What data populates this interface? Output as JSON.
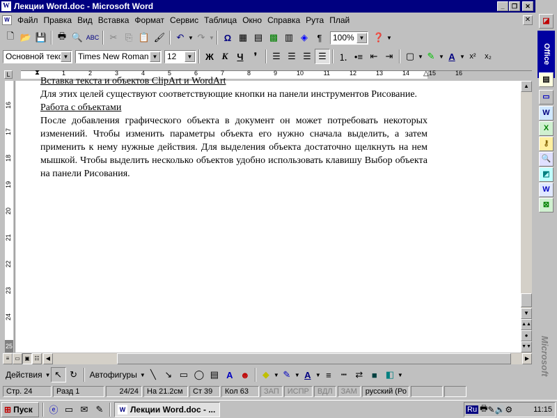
{
  "window": {
    "title": "Лекции Word.doc - Microsoft Word",
    "icon_letter": "W"
  },
  "menu": [
    "Файл",
    "Правка",
    "Вид",
    "Вставка",
    "Формат",
    "Сервис",
    "Таблица",
    "Окно",
    "Справка",
    "Рута",
    "Плай"
  ],
  "standard_toolbar": {
    "zoom": "100%"
  },
  "formatting_toolbar": {
    "style": "Основной текст",
    "font": "Times New Roman",
    "size": "12",
    "bold": "Ж",
    "italic": "К",
    "underline": "Ч",
    "superscript": "x²",
    "subscript": "x₂"
  },
  "ruler": {
    "numbers": [
      "1",
      "2",
      "3",
      "4",
      "5",
      "6",
      "7",
      "8",
      "9",
      "10",
      "11",
      "12",
      "13",
      "14",
      "15",
      "16"
    ]
  },
  "vruler": {
    "numbers": [
      "16",
      "17",
      "18",
      "19",
      "20",
      "21",
      "22",
      "23",
      "24",
      "25"
    ]
  },
  "document": {
    "line_cut": "Вставка текста и объектов ClipArt и WordArt",
    "para1": "Для этих целей существуют соответствующие кнопки на панели инструментов Рисование.",
    "heading2": "Работа с объектами",
    "para2": "После добавления графического объекта в документ он может потребовать некоторых изменений. Чтобы изменить параметры объекта его нужно сначала выделить, а затем применить к нему нужные действия. Для выделения объекта достаточно щелкнуть на нем мышкой. Чтобы выделить несколько объектов удобно использовать клавишу Выбор объекта на панели Рисования."
  },
  "drawing_toolbar": {
    "actions": "Действия",
    "autoshapes": "Автофигуры"
  },
  "status_bar": {
    "page": "Стр. 24",
    "section": "Разд 1",
    "pages": "24/24",
    "at": "На 21.2см",
    "line": "Ст 39",
    "col": "Кол 63",
    "rec": "ЗАП",
    "trk": "ИСПР",
    "ext": "ВДЛ",
    "ovr": "ЗАМ",
    "lang": "русский (Ро"
  },
  "taskbar": {
    "start": "Пуск",
    "task": "Лекции Word.doc - ...",
    "lang": "Ru",
    "time": "11:15"
  },
  "office_bar": {
    "label": "Office",
    "brand": "Microsoft"
  }
}
